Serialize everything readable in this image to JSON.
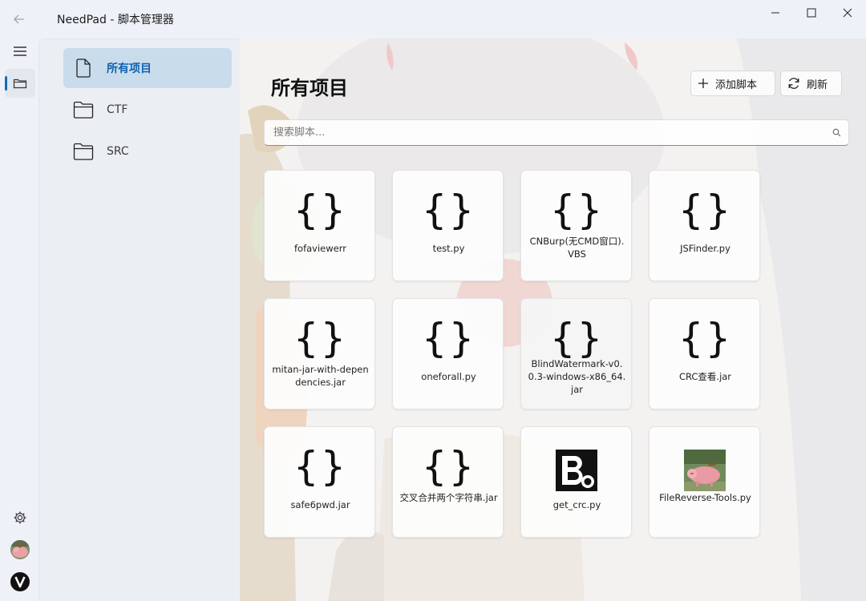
{
  "window": {
    "title": "NeedPad - 脚本管理器"
  },
  "nav": {
    "items": [
      {
        "label": "所有项目",
        "icon": "document-icon",
        "active": true
      },
      {
        "label": "CTF",
        "icon": "folder-icon",
        "active": false
      },
      {
        "label": "SRC",
        "icon": "folder-icon",
        "active": false
      }
    ]
  },
  "main": {
    "title": "所有项目",
    "add_label": "添加脚本",
    "refresh_label": "刷新",
    "search_placeholder": "搜索脚本..."
  },
  "scripts": [
    {
      "name": "fofaviewerr",
      "icon": "braces-icon"
    },
    {
      "name": "test.py",
      "icon": "braces-icon"
    },
    {
      "name": "CNBurp(无CMD窗口).VBS",
      "icon": "braces-icon"
    },
    {
      "name": "JSFinder.py",
      "icon": "braces-icon"
    },
    {
      "name": "mitan-jar-with-dependencies.jar",
      "icon": "braces-icon"
    },
    {
      "name": "oneforall.py",
      "icon": "braces-icon"
    },
    {
      "name": "BlindWatermark-v0.0.3-windows-x86_64.jar",
      "icon": "braces-icon"
    },
    {
      "name": "CRC查看.jar",
      "icon": "braces-icon"
    },
    {
      "name": "safe6pwd.jar",
      "icon": "braces-icon"
    },
    {
      "name": "交叉合并两个字符串.jar",
      "icon": "braces-icon"
    },
    {
      "name": "get_crc.py",
      "icon": "b-logo-image"
    },
    {
      "name": "FileReverse-Tools.py",
      "icon": "pig-image"
    }
  ],
  "colors": {
    "accent": "#0f6cbd",
    "nav_active_bg": "#c9dcec",
    "window_bg": "#eef2f8"
  }
}
